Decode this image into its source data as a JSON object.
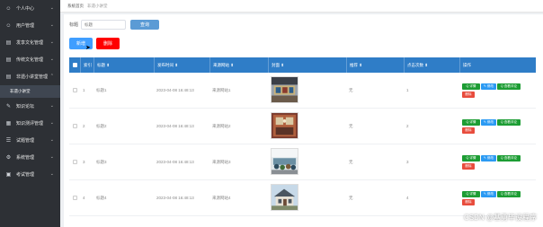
{
  "sidebar": {
    "items": [
      {
        "label": "个人中心",
        "icon": "user-icon",
        "open": false
      },
      {
        "label": "用户管理",
        "icon": "users-icon",
        "open": false
      },
      {
        "label": "发享文化管理",
        "icon": "book-icon",
        "open": false
      },
      {
        "label": "传统文化管理",
        "icon": "book-icon",
        "open": false
      },
      {
        "label": "非遗小讲堂管理",
        "icon": "book-icon",
        "open": true,
        "sub": [
          "非遗小讲堂"
        ]
      },
      {
        "label": "知识论坛",
        "icon": "forum-icon",
        "open": false
      },
      {
        "label": "知识测评管理",
        "icon": "clipboard-icon",
        "open": false
      },
      {
        "label": "试题管理",
        "icon": "list-icon",
        "open": false
      },
      {
        "label": "系统管理",
        "icon": "gear-icon",
        "open": false
      },
      {
        "label": "考试管理",
        "icon": "exam-icon",
        "open": false
      }
    ]
  },
  "breadcrumb": {
    "home": "系统首页",
    "current": "非遗小讲堂"
  },
  "search": {
    "label": "标题",
    "placeholder": "标题",
    "query_label": "查询"
  },
  "toolbar": {
    "add_label": "新增",
    "delete_label": "删除"
  },
  "table": {
    "headers": [
      "索引",
      "标题 ⬍",
      "发布时间 ⬍",
      "来源网站 ⬍",
      "封面 ⬍",
      "推荐 ⬍",
      "点击次数 ⬍",
      "操作"
    ],
    "rows": [
      {
        "index": "1",
        "title": "标题1",
        "time": "2023-04-08 16:48:13",
        "source": "来源网站1",
        "recommend": "无",
        "clicks": "1"
      },
      {
        "index": "2",
        "title": "标题2",
        "time": "2023-04-08 16:48:13",
        "source": "来源网站2",
        "recommend": "无",
        "clicks": "2"
      },
      {
        "index": "3",
        "title": "标题3",
        "time": "2023-04-08 16:48:13",
        "source": "来源网站3",
        "recommend": "无",
        "clicks": "3"
      },
      {
        "index": "4",
        "title": "标题4",
        "time": "2023-04-08 16:48:13",
        "source": "来源网站4",
        "recommend": "无",
        "clicks": "4"
      }
    ],
    "ops": {
      "detail": "Q 详情",
      "edit": "✎ 修改",
      "comment": "Q 查看评论",
      "delete": "删除"
    }
  },
  "watermark": "CSDN @基勇毕设程序",
  "colors": {
    "sidebar_bg": "#2d3035",
    "header_bg": "#2f7dc7",
    "query_btn": "#5b9bd5",
    "add_btn": "#409eff",
    "delete_btn": "#ff0000",
    "op_green": "#1d9d34",
    "op_blue": "#2b9af3"
  }
}
